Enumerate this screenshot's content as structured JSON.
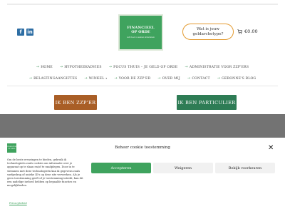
{
  "social": {
    "facebook": "f",
    "linkedin": "in"
  },
  "logo": {
    "line1": "FINANCIEEL",
    "line2": "OP ORDE",
    "tagline": "zelf doen vs samen afstemmen"
  },
  "header": {
    "cta_line1": "Wat is jouw",
    "cta_line2": "geldarchetype?",
    "cart_total": "€0.00"
  },
  "nav": {
    "row1": [
      {
        "label": "HOME",
        "has_arrow": true
      },
      {
        "label": "HYPOTHEEKADVIES",
        "has_arrow": true
      },
      {
        "label": "FOCUS THUIS – JE GELD OP ORDE",
        "has_arrow": true
      },
      {
        "label": "ADMINISTRATIE VOOR ZZP'ERS",
        "has_arrow": true
      }
    ],
    "row2": [
      {
        "label": "BELASTINGAANGIFTES",
        "has_arrow": true
      },
      {
        "label": "WINKEL",
        "has_arrow": true,
        "caret": "▾"
      },
      {
        "label": "VOOR DE ZZP'ER",
        "has_arrow": true
      },
      {
        "label": "OVER MIJ",
        "has_arrow": true
      },
      {
        "label": "CONTACT",
        "has_arrow": true
      },
      {
        "label": "GERONNE'S BLOG",
        "has_arrow": true
      }
    ]
  },
  "hero": {
    "zzp_button": "IK BEN ZZP'ER",
    "particulier_button": "IK BEN PARTICULIER"
  },
  "cookie": {
    "title": "Beheer cookie toestemming",
    "close": "✕",
    "body": "Om de beste ervaringen te bieden, gebruik ik technologieën zoals cookies om informatie over je apparaat op te slaan en/of te raadplegen. Door in te stemmen met deze technologieën kan ik gegevens zoals surfgedrag of unieke ID's op deze site verwerken. Als je geen toestemming geeft of je toestemming intrekt, kan dit een nadelige invloed hebben op bepaalde functies en mogelijkheden.",
    "accept": "Accepteren",
    "refuse": "Weigeren",
    "preferences": "Bekijk voorkeuren",
    "privacy_link": "Privacybeleid"
  },
  "colors": {
    "brand_green": "#3fa35e",
    "zzp_brown": "#a95e26",
    "particulier_green": "#2e7c55",
    "cta_border": "#e39a2f"
  }
}
